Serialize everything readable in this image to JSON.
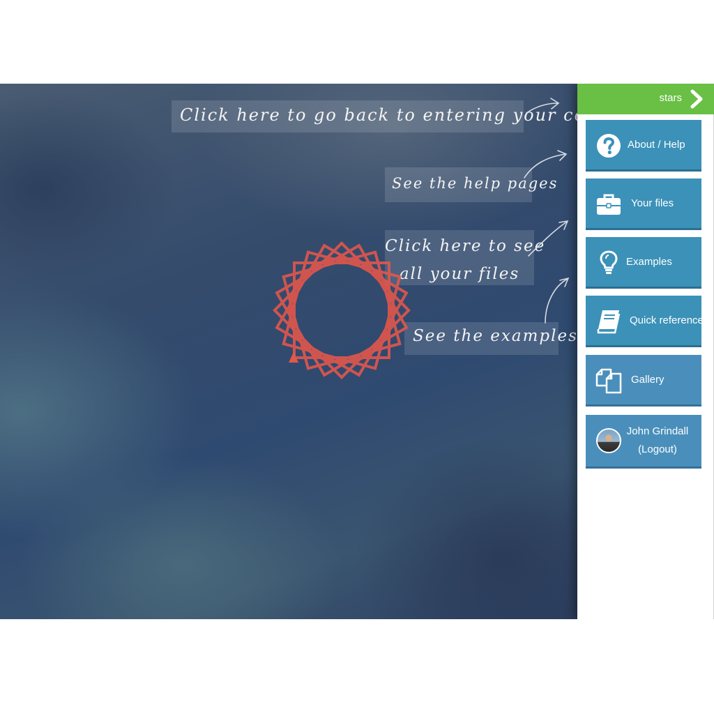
{
  "hints": {
    "back_to_code": "Click here to go back to entering your code",
    "help_pages": "See the help pages",
    "all_files_line1": "Click here to see",
    "all_files_line2": "all your files",
    "examples": "See the examples"
  },
  "sidebar": {
    "title": "stars",
    "header_icon": "chevron-right-icon",
    "items": [
      {
        "label": "About / Help",
        "icon": "question-circle-icon"
      },
      {
        "label": "Your files",
        "icon": "briefcase-icon"
      },
      {
        "label": "Examples",
        "icon": "lightbulb-icon"
      },
      {
        "label": "Quick reference",
        "icon": "book-icon"
      },
      {
        "label": "Gallery",
        "icon": "copy-icon"
      }
    ],
    "user": {
      "name": "John Grindall",
      "action": "(Logout)",
      "icon": "avatar"
    }
  },
  "colors": {
    "header_green": "#6abf45",
    "button_blue": "#3b91b8",
    "spinner_red": "#e2574c"
  }
}
